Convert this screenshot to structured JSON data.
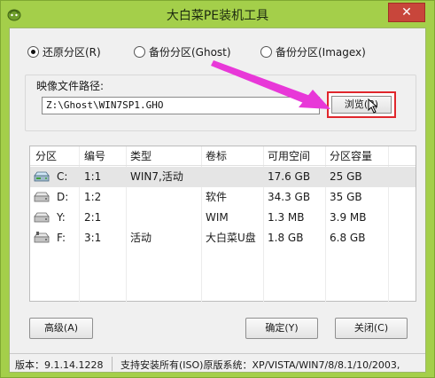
{
  "window": {
    "title": "大白菜PE装机工具",
    "close_glyph": "✕"
  },
  "mode_options": [
    {
      "label": "还原分区(R)",
      "checked": true
    },
    {
      "label": "备份分区(Ghost)",
      "checked": false
    },
    {
      "label": "备份分区(Imagex)",
      "checked": false
    }
  ],
  "path": {
    "label": "映像文件路径:",
    "value": "Z:\\Ghost\\WIN7SP1.GHO",
    "browse_label": "浏览(B)"
  },
  "table": {
    "columns": [
      "分区",
      "编号",
      "类型",
      "卷标",
      "可用空间",
      "分区容量"
    ],
    "rows": [
      {
        "partition": "C:",
        "number": "1:1",
        "type": "WIN7,活动",
        "label": "",
        "free": "17.6 GB",
        "capacity": "25 GB",
        "icon": "system-disk-icon",
        "selected": true
      },
      {
        "partition": "D:",
        "number": "1:2",
        "type": "",
        "label": "软件",
        "free": "34.3 GB",
        "capacity": "35 GB",
        "icon": "disk-icon",
        "selected": false
      },
      {
        "partition": "Y:",
        "number": "2:1",
        "type": "",
        "label": "WIM",
        "free": "1.3 MB",
        "capacity": "3.9 MB",
        "icon": "disk-icon",
        "selected": false
      },
      {
        "partition": "F:",
        "number": "3:1",
        "type": "活动",
        "label": "大白菜U盘",
        "free": "1.8 GB",
        "capacity": "6.8 GB",
        "icon": "usb-disk-icon",
        "selected": false
      }
    ]
  },
  "buttons": {
    "advanced": "高级(A)",
    "ok": "确定(Y)",
    "close": "关闭(C)"
  },
  "status": {
    "version": "版本：9.1.14.1228",
    "support": "支持安装所有(ISO)原版系统：XP/VISTA/WIN7/8/8.1/10/2003,"
  },
  "colors": {
    "frame": "#a4cf4a",
    "annotation_arrow": "#e838d8",
    "highlight_box": "#e0262c"
  }
}
